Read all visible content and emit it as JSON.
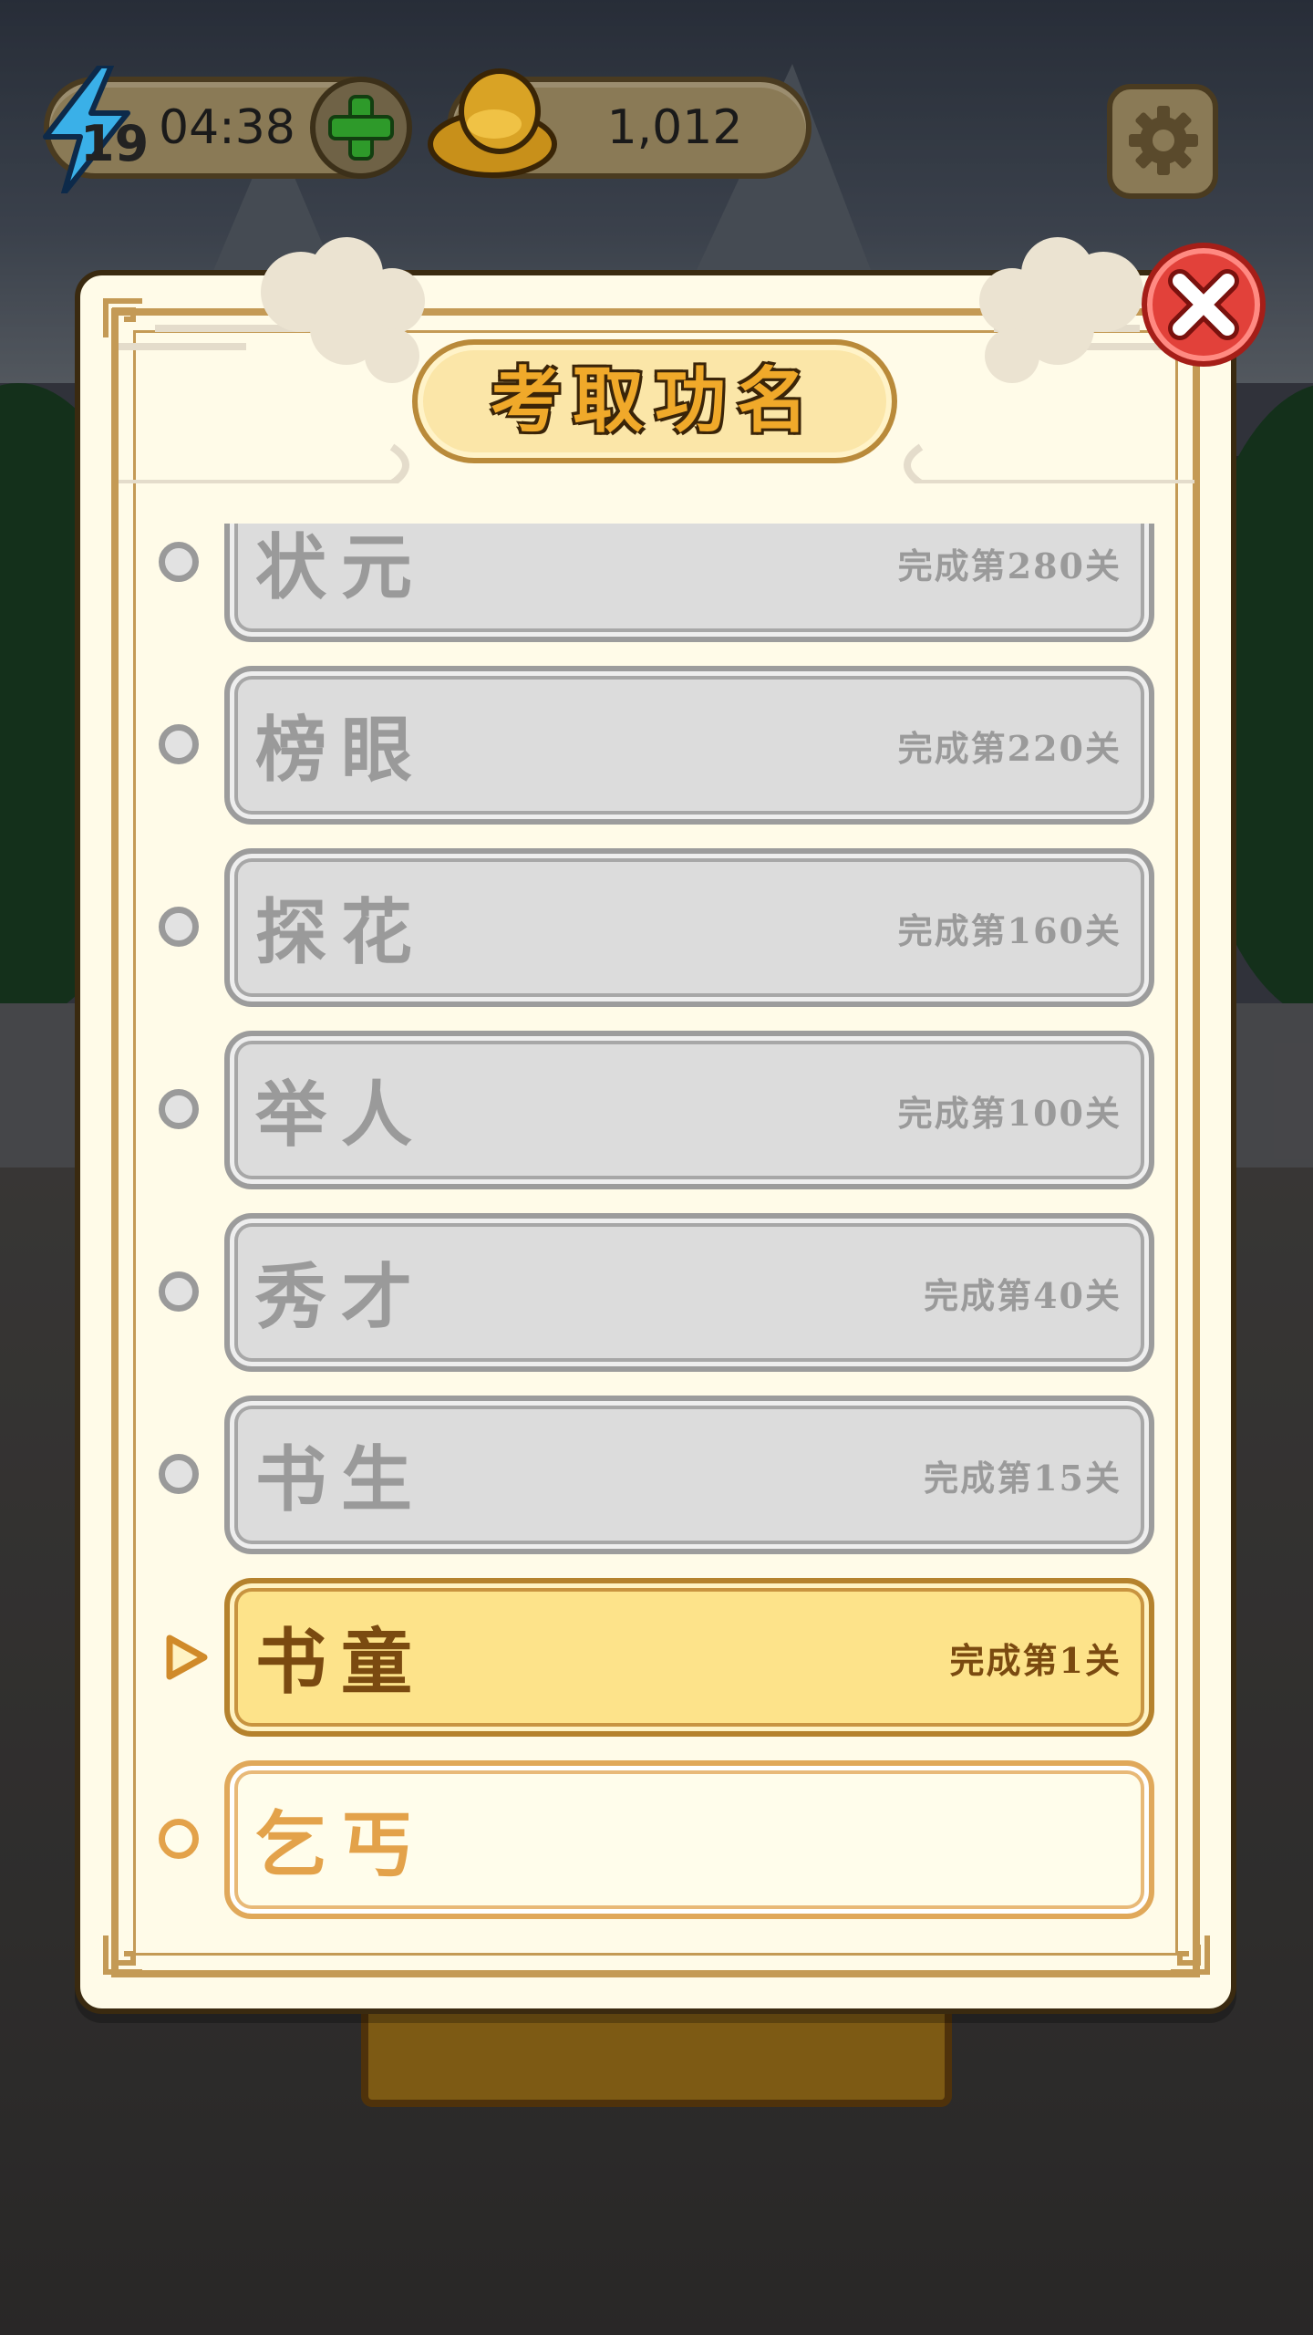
{
  "hud": {
    "energy_count": "19",
    "energy_timer": "04:38",
    "coins": "1,012"
  },
  "dialog": {
    "title": "考取功名"
  },
  "ranks": [
    {
      "name": "状元",
      "requirement": "完成第280关",
      "state": "locked"
    },
    {
      "name": "榜眼",
      "requirement": "完成第220关",
      "state": "locked"
    },
    {
      "name": "探花",
      "requirement": "完成第160关",
      "state": "locked"
    },
    {
      "name": "举人",
      "requirement": "完成第100关",
      "state": "locked"
    },
    {
      "name": "秀才",
      "requirement": "完成第40关",
      "state": "locked"
    },
    {
      "name": "书生",
      "requirement": "完成第15关",
      "state": "locked"
    },
    {
      "name": "书童",
      "requirement": "完成第1关",
      "state": "current"
    },
    {
      "name": "乞丐",
      "requirement": "",
      "state": "achieved"
    }
  ],
  "colors": {
    "accent_gold": "#f0a92a",
    "current_row": "#fde38a",
    "locked_row": "#dcdcdc",
    "close_red": "#e2413a"
  },
  "icons": [
    "lightning-icon",
    "plus-icon",
    "gold-ingot-icon",
    "gear-icon",
    "close-icon",
    "triangle-marker-icon"
  ]
}
